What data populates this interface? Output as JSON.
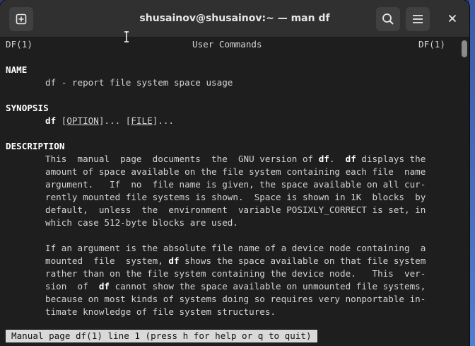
{
  "window": {
    "title": "shusainov@shusainov:~ — man df"
  },
  "icons": {
    "new_tab": "new-tab-icon",
    "search": "search-icon",
    "menu": "hamburger-menu-icon",
    "close": "close-icon"
  },
  "man": {
    "header": {
      "left": "DF(1)",
      "center": "User Commands",
      "right": "DF(1)"
    },
    "name_heading": "NAME",
    "name_text": "df - report file system space usage",
    "synopsis_heading": "SYNOPSIS",
    "synopsis": {
      "cmd": "df",
      "sp1": " [",
      "option": "OPTION",
      "mid": "]... [",
      "file": "FILE",
      "end": "]..."
    },
    "description_heading": "DESCRIPTION",
    "p1": {
      "l1_a": "This  manual  page  documents  the  GNU version of ",
      "l1_b": "df",
      "l1_c": ".  ",
      "l1_d": "df",
      "l1_e": " displays the",
      "l2": "amount of space available on the file system containing each file  name",
      "l3": "argument.   If  no  file name is given, the space available on all cur-",
      "l4": "rently mounted file systems is shown.  Space is shown in 1K  blocks  by",
      "l5": "default,  unless  the  environment  variable POSIXLY_CORRECT is set, in",
      "l6": "which case 512-byte blocks are used."
    },
    "p2": {
      "l1": "If an argument is the absolute file name of a device node containing  a",
      "l2_a": "mounted  file  system, ",
      "l2_b": "df",
      "l2_c": " shows the space available on that file system",
      "l3": "rather than on the file system containing the device node.   This  ver-",
      "l4_a": "sion  of  ",
      "l4_b": "df",
      "l4_c": " cannot show the space available on unmounted file systems,",
      "l5": "because on most kinds of systems doing so requires very nonportable in-",
      "l6": "timate knowledge of file system structures."
    },
    "status": "Manual page df(1) line 1 (press h for help or q to quit)"
  }
}
